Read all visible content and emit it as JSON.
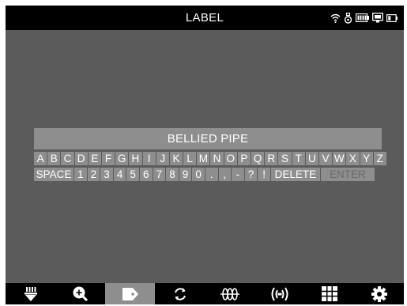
{
  "header": {
    "title": "LABEL",
    "status_icons": [
      "wifi-icon",
      "tag-icon",
      "battery-icon",
      "monitor-icon",
      "battery-small-icon"
    ]
  },
  "label_input": {
    "value": "BELLIED PIPE"
  },
  "keyboard": {
    "row1": [
      "A",
      "B",
      "C",
      "D",
      "E",
      "F",
      "G",
      "H",
      "I",
      "J",
      "K",
      "L",
      "M",
      "N",
      "O",
      "P",
      "Q",
      "R",
      "S",
      "T",
      "U",
      "V",
      "W",
      "X",
      "Y",
      "Z"
    ],
    "row2": {
      "space": "SPACE",
      "digits": [
        "1",
        "2",
        "3",
        "4",
        "5",
        "6",
        "7",
        "8",
        "9",
        "0",
        ".",
        ",",
        "-",
        "?",
        "!"
      ],
      "delete": "DELETE",
      "enter": "ENTER"
    }
  },
  "toolbar": {
    "items": [
      "probe-icon",
      "zoom-in-icon",
      "label-icon",
      "rotate-icon",
      "waveform-icon",
      "signal-icon",
      "grid-icon",
      "settings-icon"
    ],
    "active_index": 2
  },
  "colors": {
    "background": "#5b5b5b",
    "bar": "#000000",
    "key": "#8e8e8e",
    "text": "#ffffff",
    "disabled_text": "#6a6a6a"
  }
}
